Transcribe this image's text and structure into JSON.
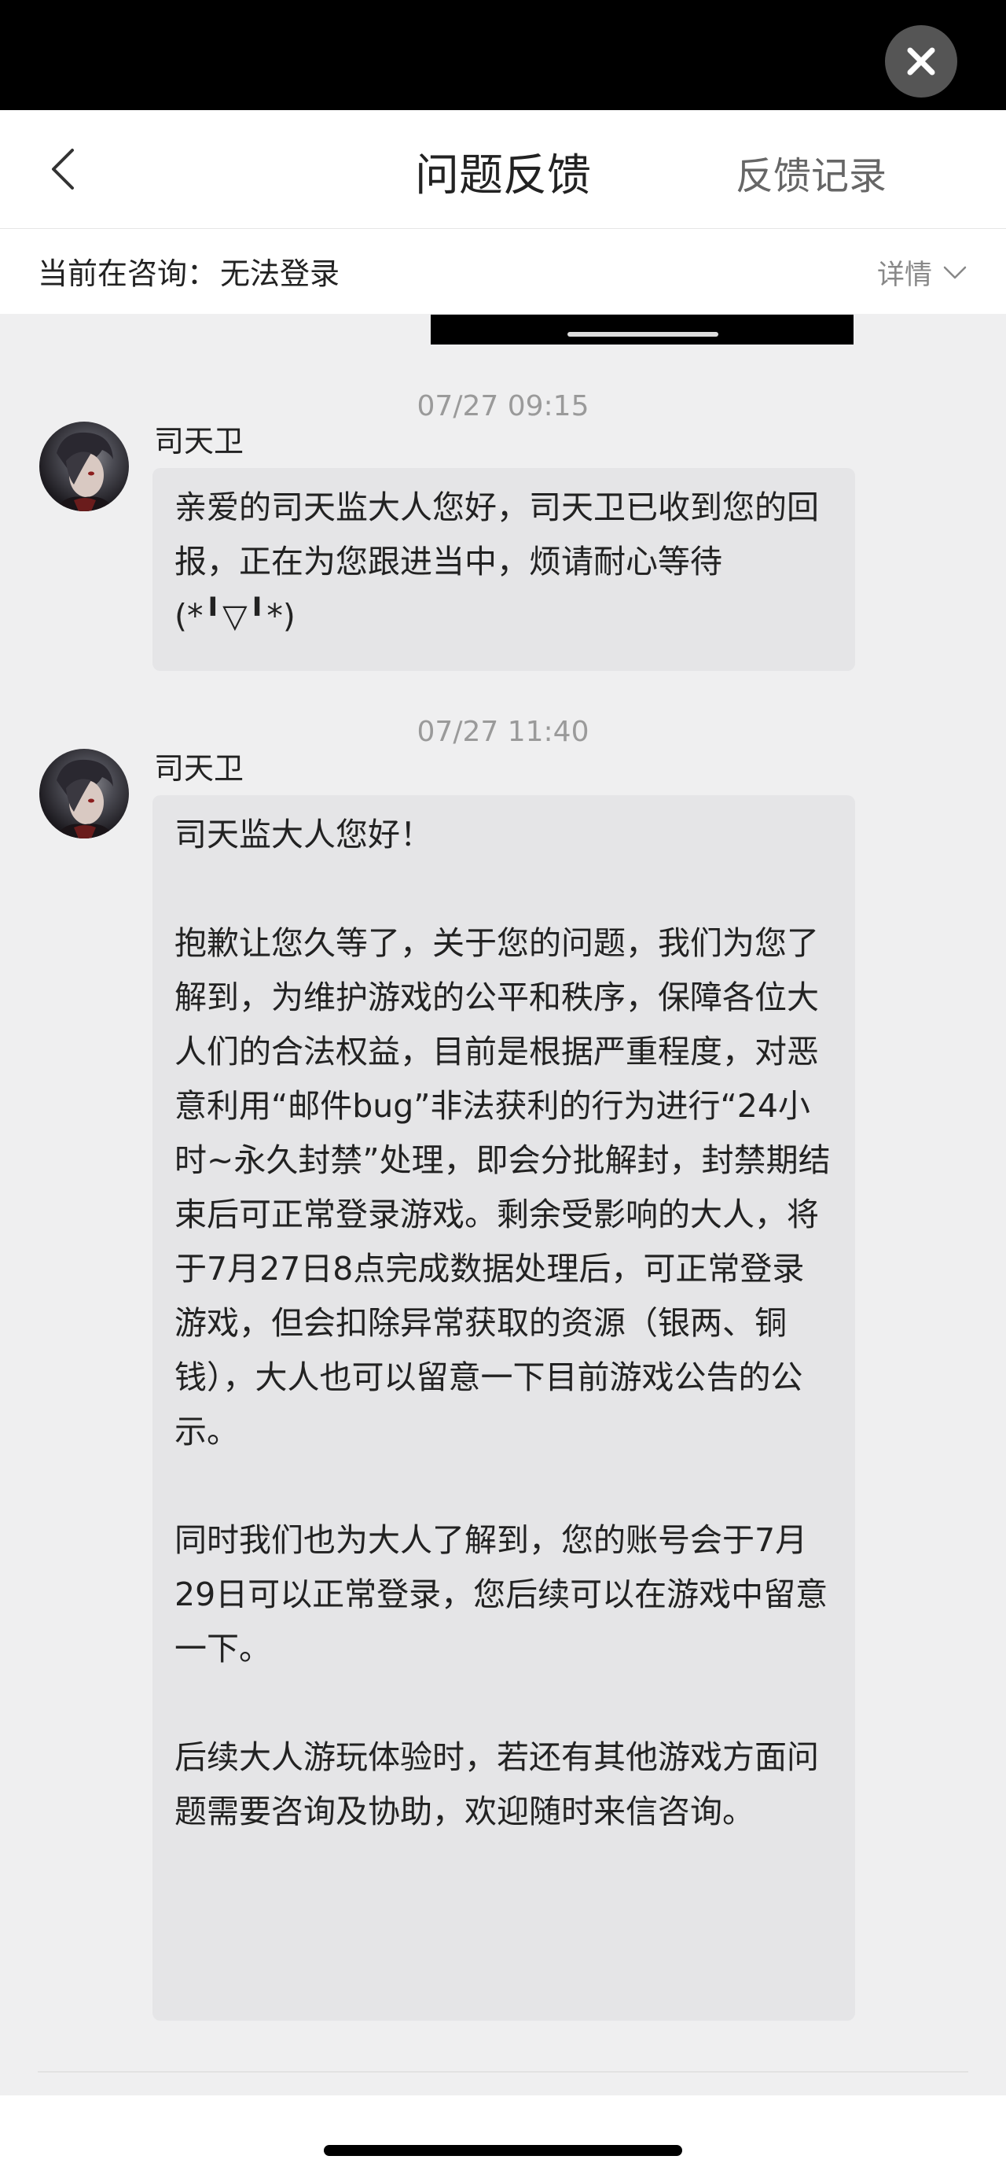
{
  "header": {
    "title": "问题反馈",
    "right_link": "反馈记录"
  },
  "consult": {
    "label": "当前在咨询：",
    "topic": "无法登录",
    "detail": "详情"
  },
  "messages": [
    {
      "time": "07/27 09:15",
      "sender": "司天卫",
      "paragraphs": [
        "亲爱的司天监大人您好，司天卫已收到您的回报，正在为您跟进当中，烦请耐心等待(*╹▽╹*)"
      ]
    },
    {
      "time": "07/27 11:40",
      "sender": "司天卫",
      "paragraphs": [
        "司天监大人您好！",
        "抱歉让您久等了，关于您的问题，我们为您了解到，为维护游戏的公平和秩序，保障各位大人们的合法权益，目前是根据严重程度，对恶意利用“邮件bug”非法获利的行为进行“24小时~永久封禁”处理，即会分批解封，封禁期结束后可正常登录游戏。剩余受影响的大人，将于7月27日8点完成数据处理后，可正常登录游戏，但会扣除异常获取的资源（银两、铜钱），大人也可以留意一下目前游戏公告的公示。",
        "同时我们也为大人了解到，您的账号会于7月29日可以正常登录，您后续可以在游戏中留意一下。",
        "后续大人游玩体验时，若还有其他游戏方面问题需要咨询及协助，欢迎随时来信咨询。"
      ]
    }
  ],
  "icons": {
    "close": "close-icon",
    "back": "chevron-left-icon",
    "detail": "chevron-down-icon"
  },
  "colors": {
    "bubble": "#e5e5e7",
    "background": "#efeff0",
    "muted_text": "#9a9a9a"
  }
}
